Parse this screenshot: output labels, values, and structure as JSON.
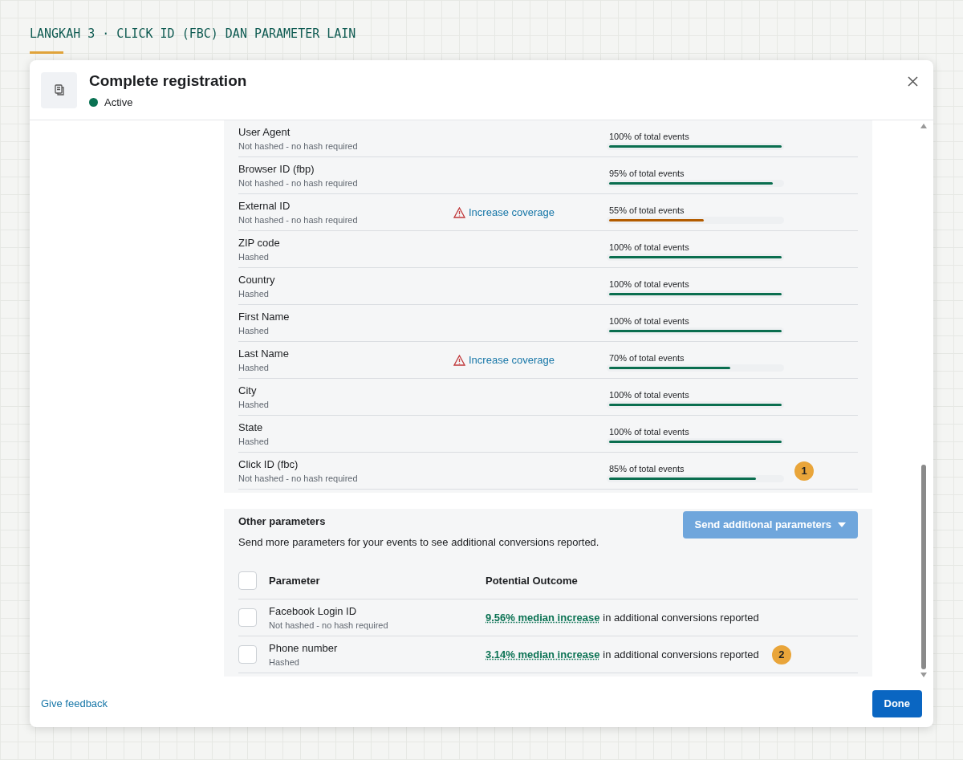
{
  "step_heading": "LANGKAH 3 · CLICK ID (FBC) DAN PARAMETER LAIN",
  "dialog": {
    "title": "Complete registration",
    "status": "Active"
  },
  "parameters": [
    {
      "name": "User Agent",
      "hashing": "Not hashed - no hash required",
      "coverage": "100% of total events",
      "level": 1.0,
      "color": "#0a6e4f"
    },
    {
      "name": "Browser ID (fbp)",
      "hashing": "Not hashed - no hash required",
      "coverage": "95% of total events",
      "level": 0.95,
      "color": "#0a6e4f"
    },
    {
      "name": "External ID",
      "hashing": "Not hashed - no hash required",
      "warning": "Increase coverage",
      "coverage": "55% of total events",
      "level": 0.55,
      "color": "#b35c00"
    },
    {
      "name": "ZIP code",
      "hashing": "Hashed",
      "coverage": "100% of total events",
      "level": 1.0,
      "color": "#0a6e4f"
    },
    {
      "name": "Country",
      "hashing": "Hashed",
      "coverage": "100% of total events",
      "level": 1.0,
      "color": "#0a6e4f"
    },
    {
      "name": "First Name",
      "hashing": "Hashed",
      "coverage": "100% of total events",
      "level": 1.0,
      "color": "#0a6e4f"
    },
    {
      "name": "Last Name",
      "hashing": "Hashed",
      "warning": "Increase coverage",
      "coverage": "70% of total events",
      "level": 0.7,
      "color": "#0a6e4f"
    },
    {
      "name": "City",
      "hashing": "Hashed",
      "coverage": "100% of total events",
      "level": 1.0,
      "color": "#0a6e4f"
    },
    {
      "name": "State",
      "hashing": "Hashed",
      "coverage": "100% of total events",
      "level": 1.0,
      "color": "#0a6e4f"
    },
    {
      "name": "Click ID (fbc)",
      "hashing": "Not hashed - no hash required",
      "coverage": "85% of total events",
      "level": 0.85,
      "color": "#0a6e4f",
      "callout": "1"
    }
  ],
  "other_parameters": {
    "title": "Other parameters",
    "description": "Send more parameters for your events to see additional conversions reported.",
    "send_button": {
      "label": "Send additional parameters",
      "disabled": true
    },
    "header_checked": false,
    "columns": [
      "Parameter",
      "Potential Outcome"
    ],
    "rows": [
      {
        "name": "Facebook Login ID",
        "hashing": "Not hashed - no hash required",
        "increase": "9.56% median increase",
        "outcome": "in additional conversions reported",
        "checked": false
      },
      {
        "name": "Phone number",
        "hashing": "Hashed",
        "increase": "3.14% median increase",
        "outcome": "in additional conversions reported",
        "checked": false,
        "callout": "2"
      }
    ]
  },
  "footer": {
    "feedback_link": "Give feedback",
    "done_button": "Done"
  }
}
